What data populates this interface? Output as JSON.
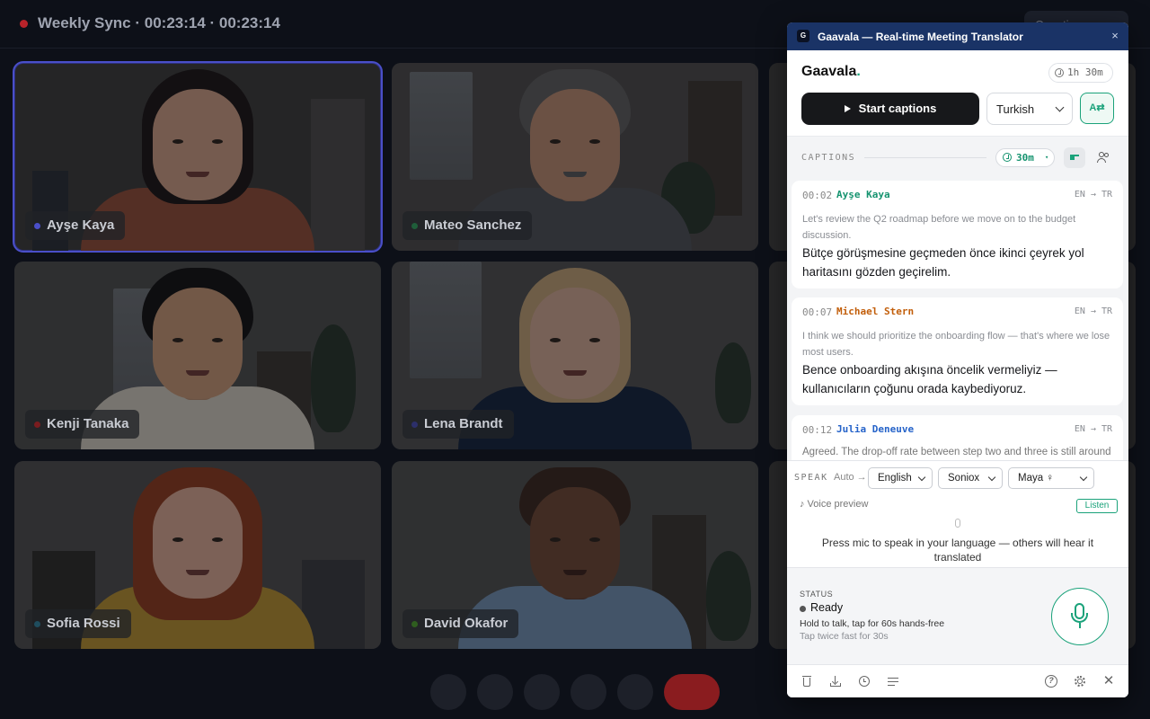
{
  "meeting": {
    "title": "Weekly Sync · 00:23:14 · 00:23:14",
    "top_button_label": "Questions",
    "participants": [
      {
        "name": "Ayşe Kaya",
        "active": true
      },
      {
        "name": "Mateo Sanchez",
        "active": false
      },
      {
        "name": "Kenji Tanaka",
        "active": false
      },
      {
        "name": "Lena Brandt",
        "active": false
      },
      {
        "name": "Sofia Rossi",
        "active": false
      },
      {
        "name": "David Okafor",
        "active": false
      }
    ],
    "controls": [
      "mic-icon",
      "camera-icon",
      "screen-share-icon",
      "chat-icon",
      "more-icon",
      "end-call"
    ]
  },
  "panel": {
    "window_title": "Gaavala — Real-time Meeting Translator",
    "app_badge": "G",
    "close_glyph": "×",
    "brand": "Gaavala",
    "brand_dot": ".",
    "quota": "1h 30m",
    "start_label": "Start captions",
    "target_language": "Turkish",
    "translate_icon_text": "A⇄",
    "captions_label": "CAPTIONS",
    "captions_duration": "30m",
    "captions": [
      {
        "time": "00:02",
        "speaker": "Ayşe Kaya",
        "speaker_color": "#15936f",
        "lang": "EN → TR",
        "source": "Let's review the Q2 roadmap before we move on to the budget discussion.",
        "translation": "Bütçe görüşmesine geçmeden önce ikinci çeyrek yol haritasını gözden geçirelim."
      },
      {
        "time": "00:07",
        "speaker": "Michael Stern",
        "speaker_color": "#c25e0a",
        "lang": "EN → TR",
        "source": "I think we should prioritize the onboarding flow — that's where we lose most users.",
        "translation": "Bence onboarding akışına öncelik vermeliyiz — kullanıcıların çoğunu orada kaybediyoruz."
      },
      {
        "time": "00:12",
        "speaker": "Julia Deneuve",
        "speaker_color": "#2563c9",
        "lang": "EN → TR",
        "source": "Agreed. The drop-off rate between step two and three is still around",
        "translation": ""
      }
    ],
    "speak": {
      "label": "SPEAK",
      "auto_label": "Auto →",
      "language": "English",
      "engine": "Soniox",
      "voice": "Maya ♀",
      "voice_preview_label": "♪ Voice preview",
      "listen_label": "Listen",
      "hint": "Press mic to speak in your language — others will hear it translated"
    },
    "status": {
      "label": "STATUS",
      "value": "Ready",
      "hint_primary": "Hold to talk, tap for 60s hands-free",
      "hint_secondary": "Tap twice fast for 30s"
    },
    "accent_color": "#1aa27a",
    "titlebar_color": "#1a3366",
    "footer_icons": [
      "trash-icon",
      "download-icon",
      "history-icon",
      "transcript-icon",
      "help-icon",
      "settings-icon",
      "close-icon"
    ]
  }
}
